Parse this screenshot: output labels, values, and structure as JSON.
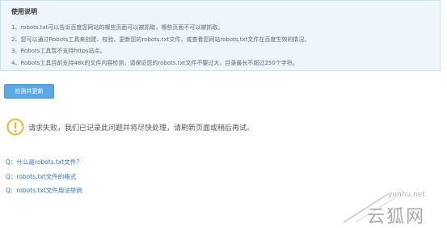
{
  "notice": {
    "title": "使用说明",
    "items": [
      "1、robots.txt可以告诉百度您网站的哪些页面可以被抓取，哪些页面不可以被抓取。",
      "2、您可以通过Robots工具来创建、校验、更新您的robots.txt文件，或查看您网站robots.txt文件在百度生效的情况。",
      "3、Robots工具暂不支持https站点。",
      "4、Robots工具目前支持48k的文件内容检测，请保证您的robots.txt文件不要过大，目录最长不超过250个字符。"
    ]
  },
  "check_button": {
    "label": "检测并更新"
  },
  "error": {
    "icon": "warning-circle-icon",
    "message": "请求失败，我们已记录此问题并将尽快处理，请刷新页面或稍后再试。"
  },
  "faq": [
    "Q：什么是robots.txt文件？",
    "Q：robots.txt文件的格式",
    "Q：robots.txt文件用法举例"
  ],
  "watermark": {
    "url": "yunhu.net",
    "text": "云狐网"
  },
  "colors": {
    "notice_bg": "#eef6fb",
    "notice_border": "#c9e0ee",
    "button_bg": "#5aa9e6",
    "link": "#2b73c6",
    "warning": "#e9b730"
  }
}
